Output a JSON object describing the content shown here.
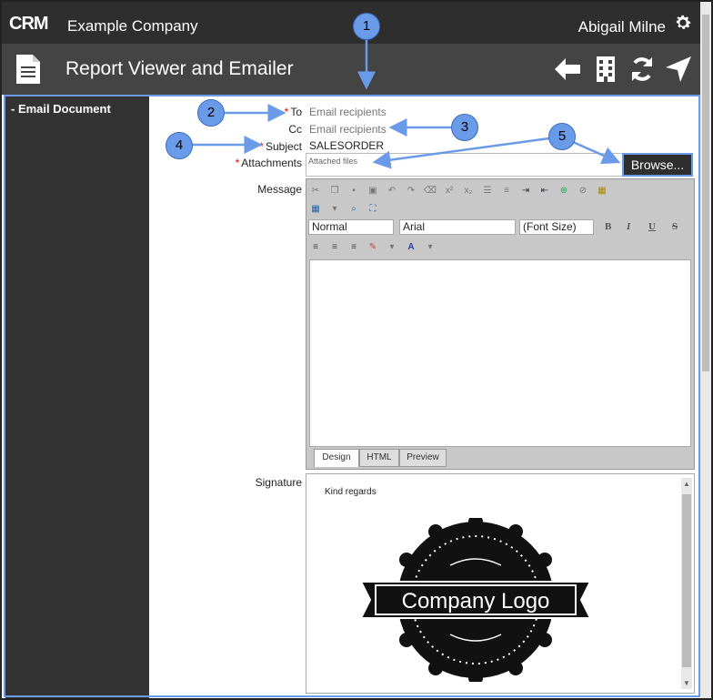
{
  "app": {
    "brand_logo_text": "CRM",
    "company_name": "Example Company",
    "user_name": "Abigail Milne"
  },
  "toolbar": {
    "title": "Report Viewer and Emailer",
    "icons": [
      "back-arrow-icon",
      "building-icon",
      "refresh-icon",
      "navigate-icon"
    ]
  },
  "sidebar": {
    "items": [
      {
        "label": "Email Document"
      }
    ]
  },
  "form": {
    "to_label": "To",
    "to_placeholder": "Email recipients",
    "cc_label": "Cc",
    "cc_placeholder": "Email recipients",
    "subject_label": "Subject",
    "subject_value": "SALESORDER",
    "attachments_label": "Attachments",
    "attachments_placeholder": "Attached files",
    "browse_label": "Browse...",
    "message_label": "Message",
    "signature_label": "Signature",
    "required_marker": "*"
  },
  "editor": {
    "paragraph_format": "Normal",
    "font_name": "Arial",
    "font_size": "(Font Size)",
    "format_buttons": [
      "B",
      "I",
      "U",
      "S"
    ],
    "tabs": [
      "Design",
      "HTML",
      "Preview"
    ],
    "active_tab": "Design"
  },
  "signature": {
    "text": "Kind regards",
    "logo_text": "Company Logo"
  },
  "callouts": [
    "1",
    "2",
    "3",
    "4",
    "5"
  ],
  "colors": {
    "accent": "#6a9be8",
    "topbar": "#2e2e2e",
    "subbar": "#444444",
    "sidebar": "#333333",
    "required": "#dd0000"
  }
}
